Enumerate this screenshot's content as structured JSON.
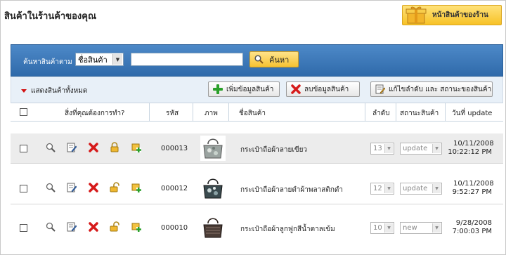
{
  "page": {
    "title": "สินค้าในร้านค้าของคุณ",
    "shop_button": "หน้าสินค้าของร้าน"
  },
  "search": {
    "label": "ค้นหาสินค้าตาม :",
    "field_option": "ชื่อสินค้า",
    "query": "",
    "button": "ค้นหา"
  },
  "toolbar": {
    "show_all": "แสดงสินค้าทั้งหมด",
    "add_label": "เพิ่มข้อมูลสินค้า",
    "delete_label": "ลบข้อมูลสินค้า",
    "edit_label": "แก้ไขลำดับ และ สถานะของสินค้า"
  },
  "table": {
    "headers": {
      "actions": "สิ่งที่คุณต้องการทำ?",
      "code": "รหัส",
      "image": "ภาพ",
      "name": "ชื่อสินค้า",
      "order": "ลำดับ",
      "status": "สถานะสินค้า",
      "updated": "วันที่ update"
    },
    "rows": [
      {
        "code": "000013",
        "name": "กระเป๋าถือผ้าลายเขียว",
        "order": "13",
        "status": "update",
        "date": "10/11/2008",
        "time": "10:22:12 PM"
      },
      {
        "code": "000012",
        "name": "กระเป๋าถือผ้าลายดำผ้าพลาสติกดำ",
        "order": "12",
        "status": "update",
        "date": "10/11/2008",
        "time": "9:52:27 PM"
      },
      {
        "code": "000010",
        "name": "กระเป๋าถือผ้าลูกฟูกสีน้ำตาลเข้ม",
        "order": "10",
        "status": "new",
        "date": "9/28/2008",
        "time": "7:00:03 PM"
      }
    ]
  },
  "colors": {
    "header_blue": "#3b78b8",
    "accent_yellow": "#f6c232",
    "delete_red": "#d61a1a",
    "add_green": "#2aa02a"
  }
}
